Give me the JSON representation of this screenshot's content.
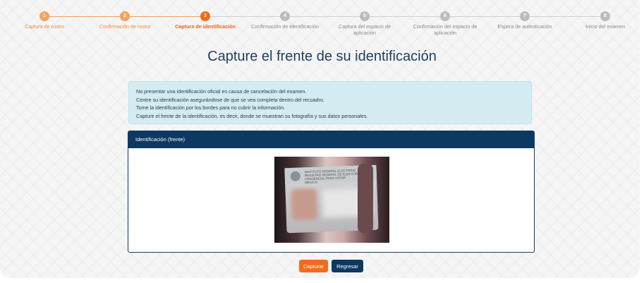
{
  "stepper": {
    "steps": [
      {
        "number": "1",
        "label": "Captura de rostro",
        "state": "done"
      },
      {
        "number": "2",
        "label": "Confirmación de rostro",
        "state": "done"
      },
      {
        "number": "3",
        "label": "Captura de identificación",
        "state": "active"
      },
      {
        "number": "4",
        "label": "Confirmación de identificación",
        "state": "pending"
      },
      {
        "number": "5",
        "label": "Captura del espacio de aplicación",
        "state": "pending"
      },
      {
        "number": "6",
        "label": "Confirmación del espacio de aplicación",
        "state": "pending"
      },
      {
        "number": "7",
        "label": "Espera de autenticación",
        "state": "pending"
      },
      {
        "number": "8",
        "label": "Inicio del examen",
        "state": "pending"
      }
    ]
  },
  "page": {
    "title": "Capture el frente de su identificación"
  },
  "instructions": [
    "No presentar una identificación oficial es causa de cancelación del examen.",
    "Centre su identificación asegurándose de que se vea completa dentro del recuadro.",
    "Tome la identificación por los bordes para no cubrir la información.",
    "Capture el frente de la identificación, es decir, donde se muestran su fotografía y sus datos personales."
  ],
  "card": {
    "header": "Identificación (frente)",
    "id_text": [
      "INSTITUTO FEDERAL ELECTORAL",
      "REGISTRO FEDERAL DE ELECTORES",
      "CREDENCIAL PARA VOTAR"
    ],
    "id_country": "MÉXICO"
  },
  "actions": {
    "capture_label": "Capturar",
    "back_label": "Regresar"
  },
  "colors": {
    "accent_orange": "#f26b1d",
    "navy": "#0d3862",
    "title": "#1e3e5f",
    "alert_bg": "#d3ecf1"
  }
}
